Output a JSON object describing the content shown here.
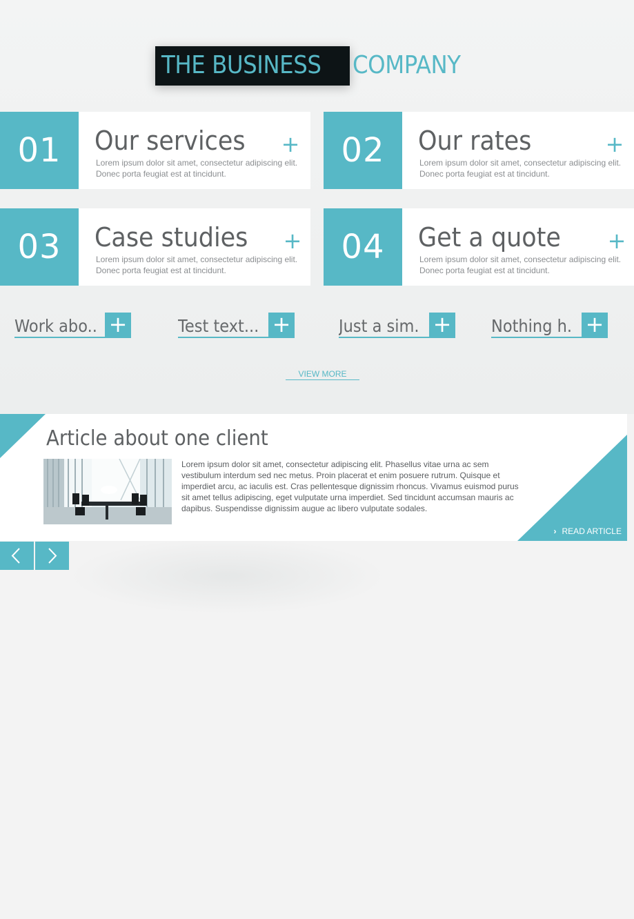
{
  "brand": {
    "title_part1": "THE BUSINESS",
    "title_part2": "COMPANY",
    "accent_color": "#57b8c6",
    "dark_color": "#0d1416"
  },
  "services": [
    {
      "number": "01",
      "title": "Our services",
      "description": "Lorem ipsum dolor sit amet, consectetur adipiscing elit. Donec porta feugiat est at tincidunt.",
      "icon": "plus-icon"
    },
    {
      "number": "02",
      "title": "Our rates",
      "description": "Lorem ipsum dolor sit amet, consectetur adipiscing elit. Donec porta feugiat est at tincidunt.",
      "icon": "plus-icon"
    },
    {
      "number": "03",
      "title": "Case studies",
      "description": "Lorem ipsum dolor sit amet, consectetur adipiscing elit. Donec porta feugiat est at tincidunt.",
      "icon": "plus-icon"
    },
    {
      "number": "04",
      "title": "Get a quote",
      "description": "Lorem ipsum dolor sit amet, consectetur adipiscing elit. Donec porta feugiat est at tincidunt.",
      "icon": "plus-icon"
    }
  ],
  "tabs": [
    {
      "label": "Work abo...",
      "icon": "plus-icon"
    },
    {
      "label": "Test text...",
      "icon": "plus-icon"
    },
    {
      "label": "Just a sim...",
      "icon": "plus-icon"
    },
    {
      "label": "Nothing h...",
      "icon": "plus-icon"
    }
  ],
  "view_more": "VIEW MORE",
  "article": {
    "title": "Article about one client",
    "body": "Lorem ipsum dolor sit amet, consectetur adipiscing elit. Phasellus vitae urna ac sem vestibulum interdum sed nec metus. Proin placerat et enim posuere rutrum. Quisque et imperdiet arcu, ac iaculis est. Cras pellentesque dignissim rhoncus. Vivamus euismod purus sit amet tellus adipiscing, eget vulputate urna imperdiet. Sed tincidunt accumsan mauris ac dapibus. Suspendisse dignissim augue ac libero vulputate sodales.",
    "read_label": "READ ARTICLE",
    "read_icon": "chevron-right-icon",
    "image": "conference-room-photo"
  },
  "nav": {
    "prev_icon": "chevron-left-icon",
    "next_icon": "chevron-right-icon"
  }
}
